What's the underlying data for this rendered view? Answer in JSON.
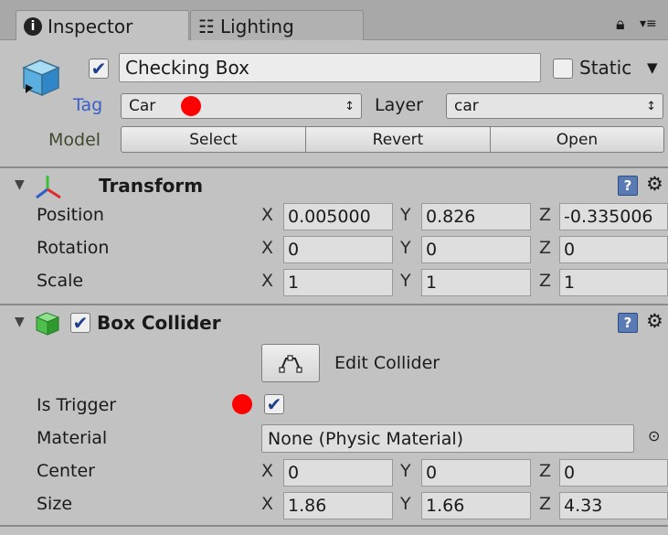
{
  "tabs": [
    {
      "label": "Inspector",
      "icon": "info-icon",
      "active": true
    },
    {
      "label": "Lighting",
      "icon": "sliders-icon",
      "active": false
    }
  ],
  "gameobject": {
    "active": true,
    "name": "Checking Box",
    "static_label": "Static",
    "static_checked": false,
    "tag_label": "Tag",
    "tag_value": "Car",
    "layer_label": "Layer",
    "layer_value": "car",
    "model_label": "Model",
    "model_buttons": [
      "Select",
      "Revert",
      "Open"
    ]
  },
  "transform": {
    "title": "Transform",
    "rows": [
      {
        "label": "Position",
        "x": "0.005000",
        "y": "0.826",
        "z": "-0.335006"
      },
      {
        "label": "Rotation",
        "x": "0",
        "y": "0",
        "z": "0"
      },
      {
        "label": "Scale",
        "x": "1",
        "y": "1",
        "z": "1"
      }
    ]
  },
  "box_collider": {
    "title": "Box Collider",
    "enabled": true,
    "edit_collider_label": "Edit Collider",
    "is_trigger_label": "Is Trigger",
    "is_trigger": true,
    "material_label": "Material",
    "material_value": "None (Physic Material)",
    "center": {
      "label": "Center",
      "x": "0",
      "y": "0",
      "z": "0"
    },
    "size": {
      "label": "Size",
      "x": "1.86",
      "y": "1.66",
      "z": "4.33"
    }
  },
  "axis_labels": {
    "x": "X",
    "y": "Y",
    "z": "Z"
  },
  "colors": {
    "tag_label": "#3a5fc8",
    "annotation_dot": "#ff0000",
    "checkmark": "#1f3f8a"
  }
}
